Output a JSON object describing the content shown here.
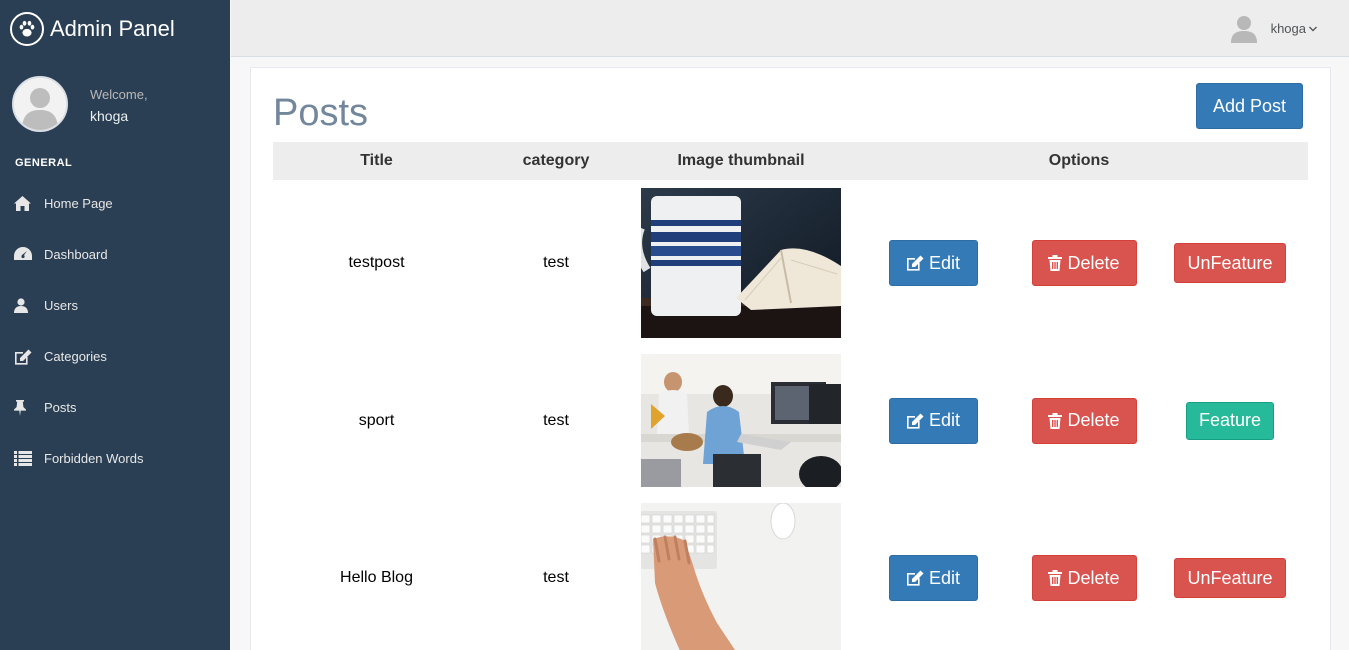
{
  "brand": {
    "title": "Admin Panel",
    "logo_icon": "paw-icon"
  },
  "profile": {
    "welcome": "Welcome,",
    "name": "khoga"
  },
  "sidebar": {
    "section_title": "GENERAL",
    "items": [
      {
        "label": "Home Page",
        "icon": "home-icon"
      },
      {
        "label": "Dashboard",
        "icon": "dashboard-icon"
      },
      {
        "label": "Users",
        "icon": "user-icon"
      },
      {
        "label": "Categories",
        "icon": "edit-icon"
      },
      {
        "label": "Posts",
        "icon": "thumbtack-icon"
      },
      {
        "label": "Forbidden Words",
        "icon": "list-icon"
      }
    ]
  },
  "topnav": {
    "user_name": "khoga",
    "caret": "⌵"
  },
  "main": {
    "title": "Posts",
    "add_label": "Add Post",
    "columns": [
      "Title",
      "category",
      "Image thumbnail",
      "Options"
    ],
    "rows": [
      {
        "title": "testpost",
        "category": "test",
        "thumb": "coffee-mug-notebook",
        "edit": "Edit",
        "delete": "Delete",
        "feature": "UnFeature"
      },
      {
        "title": "sport",
        "category": "test",
        "thumb": "office-workers",
        "edit": "Edit",
        "delete": "Delete",
        "feature": "Feature"
      },
      {
        "title": "Hello Blog",
        "category": "test",
        "thumb": "hand-keyboard",
        "edit": "Edit",
        "delete": "Delete",
        "feature": "UnFeature"
      }
    ]
  },
  "colors": {
    "sidebar_bg": "#2a3f54",
    "primary": "#337ab7",
    "danger": "#d9534f",
    "success": "#26b99a",
    "title": "#73879c"
  }
}
